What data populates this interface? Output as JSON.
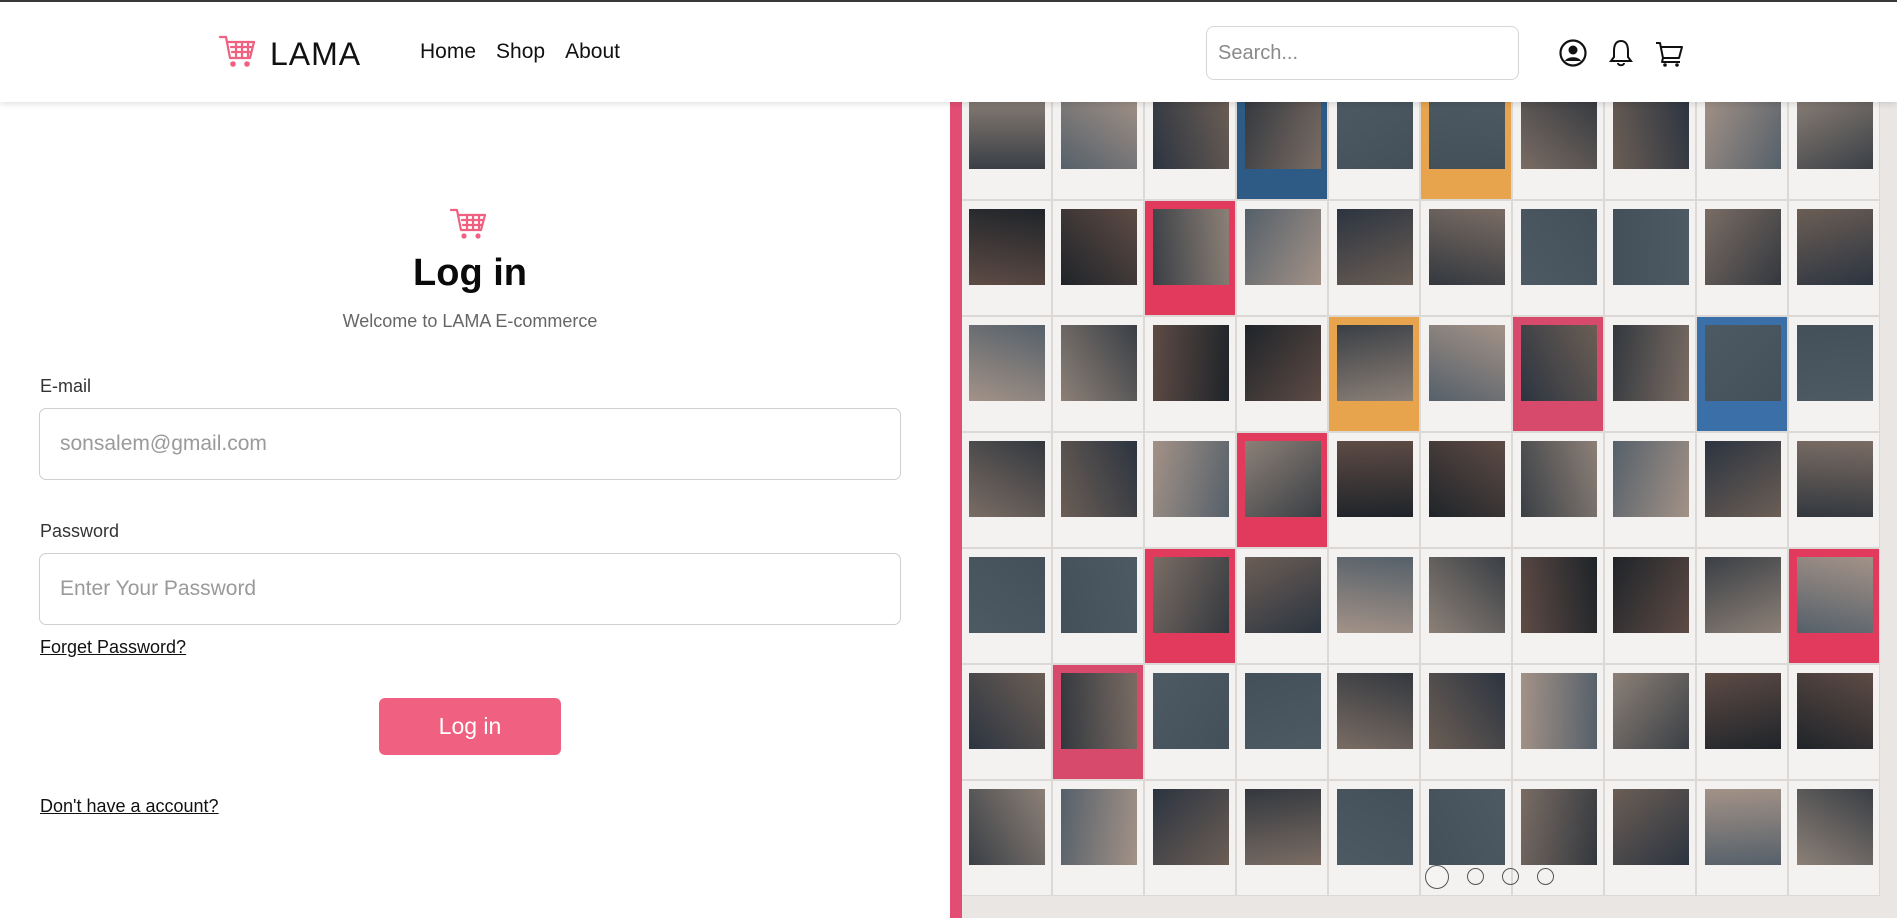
{
  "brand": {
    "name": "LAMA",
    "accent": "#f06181"
  },
  "nav": {
    "items": [
      "Home",
      "Shop",
      "About"
    ]
  },
  "header": {
    "search_placeholder": "Search...",
    "icons": [
      "user-circle-icon",
      "bell-icon",
      "cart-icon"
    ]
  },
  "login": {
    "title": "Log in",
    "subtitle": "Welcome to LAMA E-commerce",
    "email_label": "E-mail",
    "email_placeholder": "sonsalem@gmail.com",
    "password_label": "Password",
    "password_placeholder": "Enter Your Password",
    "forgot_link": "Forget Password?",
    "submit_label": "Log in",
    "signup_link": "Don't have a account?"
  },
  "carousel": {
    "slide_count": 4,
    "active_index": 0
  }
}
